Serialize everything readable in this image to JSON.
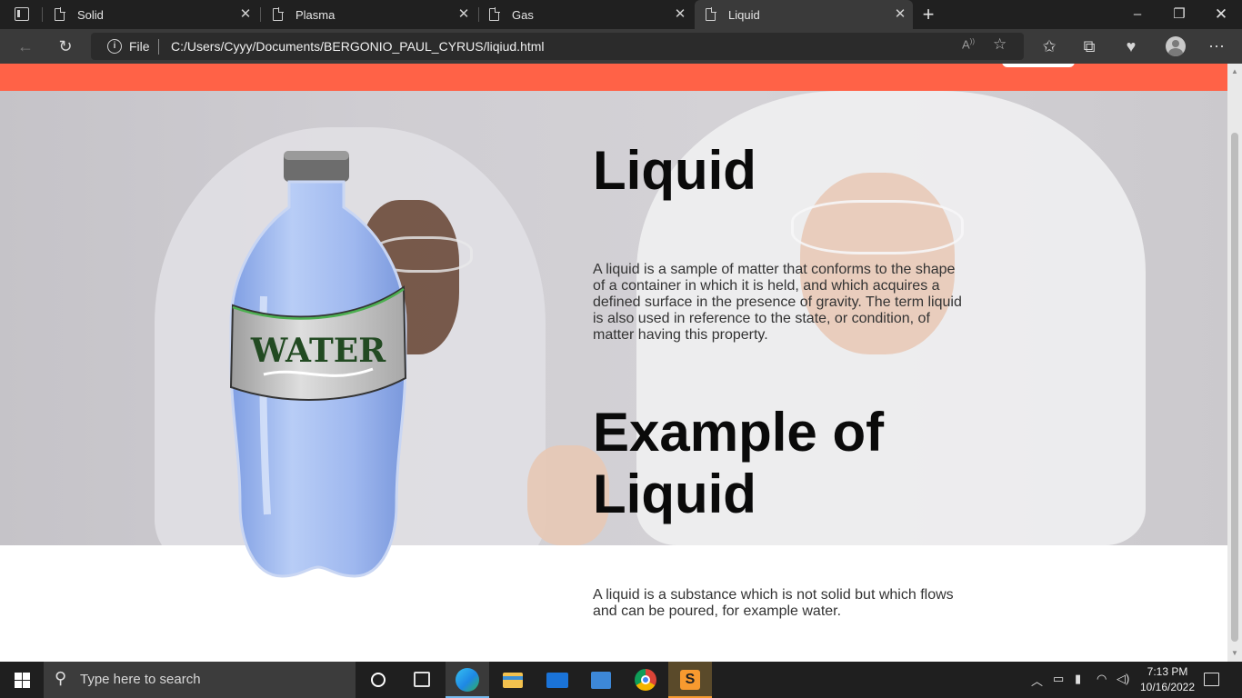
{
  "browser": {
    "tabs": [
      {
        "label": "Solid"
      },
      {
        "label": "Plasma"
      },
      {
        "label": "Gas"
      },
      {
        "label": "Liquid"
      }
    ],
    "address": {
      "scheme_label": "File",
      "url": "C:/Users/Cyyy/Documents/BERGONIO_PAUL_CYRUS/liqiud.html"
    }
  },
  "page": {
    "heading": "Liquid",
    "intro": "A liquid is a sample of matter that conforms to the shape of a container in which it is held, and which acquires a defined surface in the presence of gravity. The term liquid is also used in reference to the state, or condition, of matter having this property.",
    "example_heading": "Example of Liquid",
    "example_text": "A liquid is a substance which is not solid but which flows and can be poured, for example water.",
    "bottle_label": "WATER",
    "accent_color": "#ff6247"
  },
  "taskbar": {
    "search_placeholder": "Type here to search",
    "time": "7:13 PM",
    "date": "10/16/2022"
  },
  "icons": [
    "tab-actions-icon",
    "page-icon",
    "close-icon",
    "new-tab-icon",
    "minimize-icon",
    "restore-icon",
    "window-close-icon",
    "back-icon",
    "refresh-icon",
    "info-icon",
    "read-aloud-icon",
    "add-favorite-icon",
    "favorites-icon",
    "collections-icon",
    "health-icon",
    "profile-icon",
    "more-icon",
    "windows-start-icon",
    "search-icon",
    "cortana-icon",
    "task-view-icon",
    "edge-icon",
    "file-explorer-icon",
    "mail-icon",
    "photos-icon",
    "chrome-icon",
    "sublime-icon",
    "chevron-up-icon",
    "meet-icon",
    "battery-icon",
    "wifi-icon",
    "volume-icon",
    "notifications-icon"
  ]
}
